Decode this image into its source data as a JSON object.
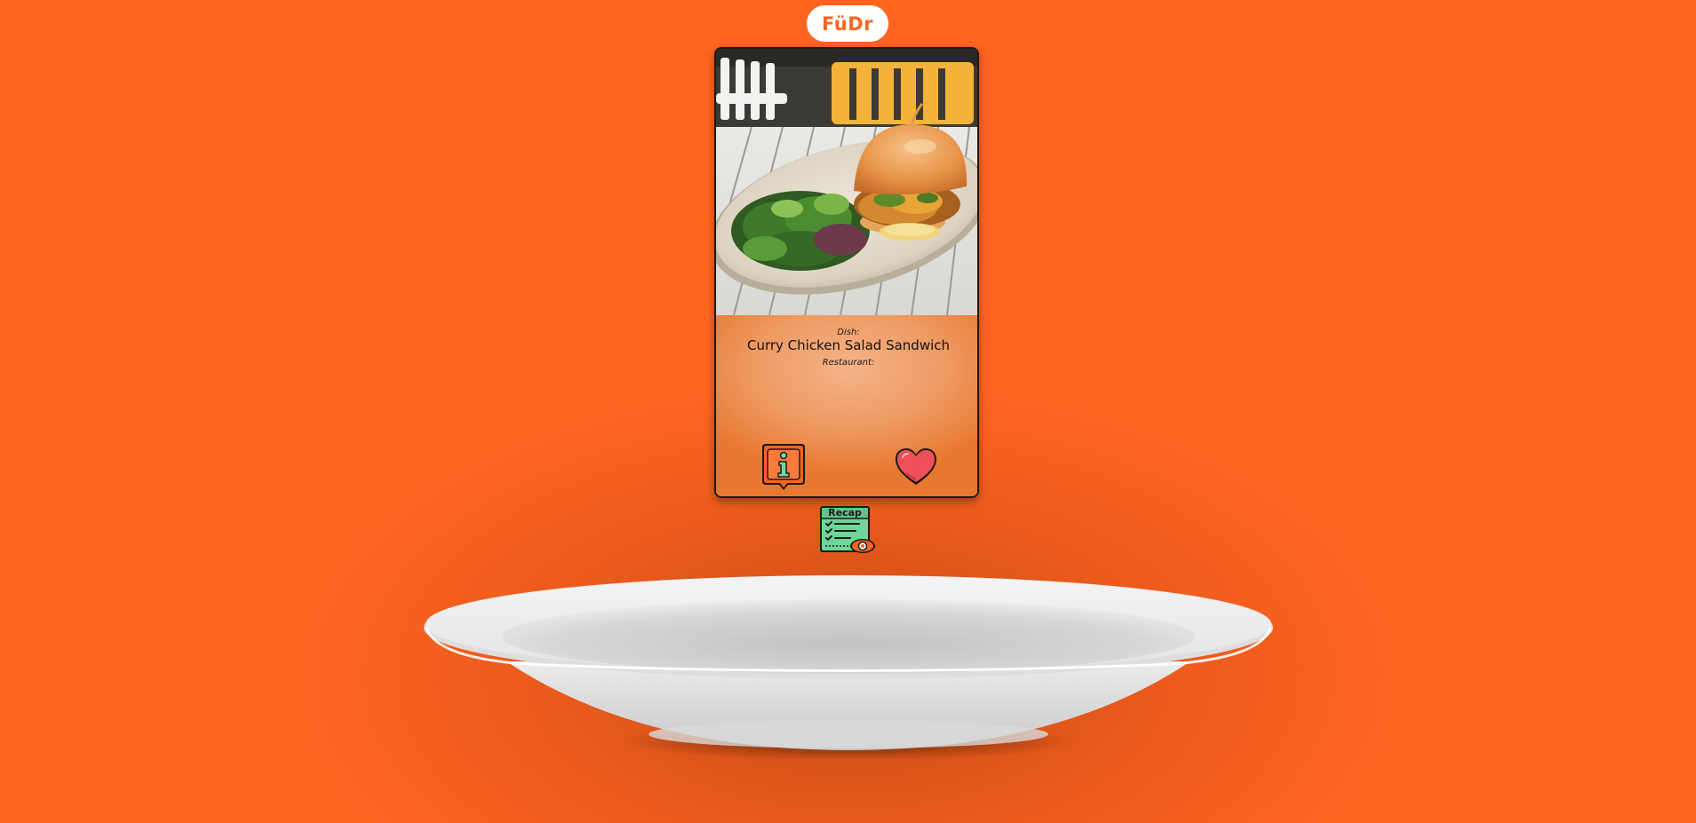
{
  "app": {
    "logo_text": "FüDr"
  },
  "card": {
    "dish_label": "Dish:",
    "dish_name": "Curry Chicken Salad Sandwich",
    "restaurant_label": "Restaurant:",
    "restaurant_name": ""
  },
  "buttons": {
    "info_icon": "info-icon",
    "like_icon": "heart-icon",
    "recap_label": "Recap"
  },
  "colors": {
    "background": "#ff6421",
    "accent": "#ff6421",
    "heart": "#f0505a",
    "recap": "#6ed69a"
  }
}
